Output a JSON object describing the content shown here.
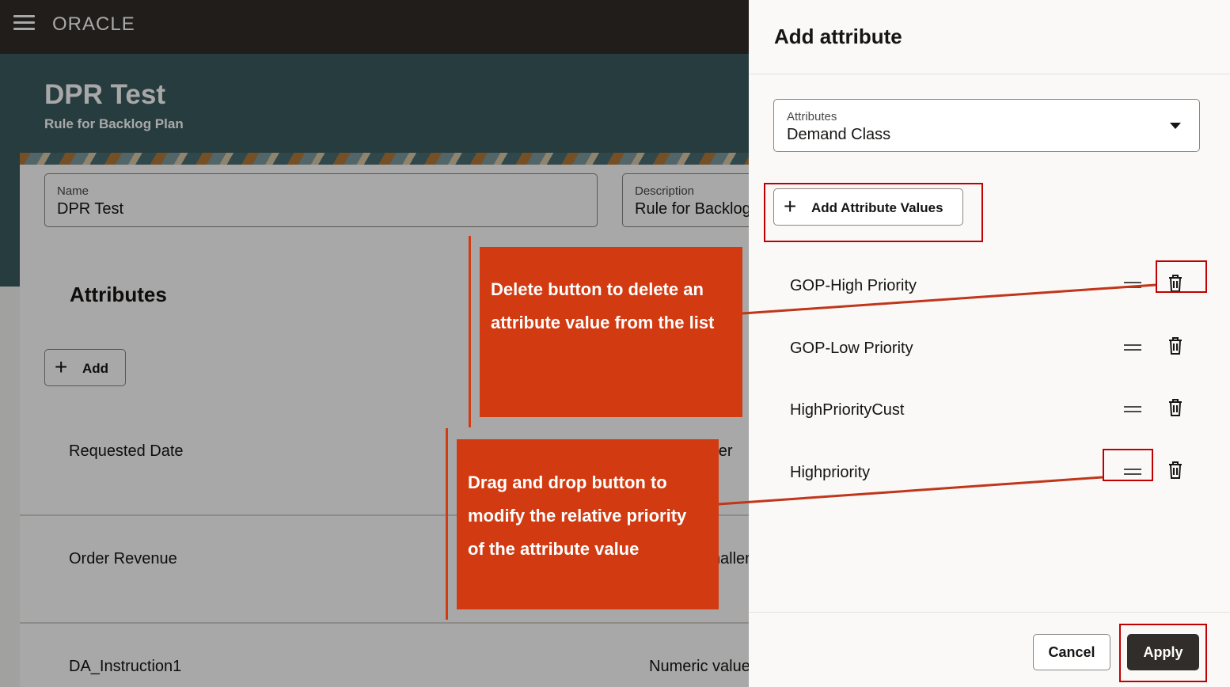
{
  "header": {
    "logo": "ORACLE"
  },
  "hero": {
    "title": "DPR Test",
    "subtitle": "Rule for Backlog Plan"
  },
  "form": {
    "name_label": "Name",
    "name_value": "DPR Test",
    "description_label": "Description",
    "description_value": "Rule for Backlog Plan"
  },
  "attributes_section": {
    "title": "Attributes",
    "add_label": "Add",
    "rows": [
      {
        "name": "Requested Date",
        "value": "Later"
      },
      {
        "name": "Order Revenue",
        "value": "Smaller"
      },
      {
        "name": "DA_Instruction1",
        "value": "Numeric value"
      }
    ]
  },
  "drawer": {
    "title": "Add attribute",
    "select_label": "Attributes",
    "select_value": "Demand Class",
    "add_values_label": "Add Attribute Values",
    "values": [
      {
        "name": "GOP-High Priority"
      },
      {
        "name": "GOP-Low Priority"
      },
      {
        "name": "HighPriorityCust"
      },
      {
        "name": "Highpriority"
      }
    ],
    "cancel_label": "Cancel",
    "apply_label": "Apply"
  },
  "annotations": {
    "delete_callout": "Delete button to delete an attribute value from the list",
    "drag_callout": "Drag and drop button to modify the relative priority of the attribute value"
  },
  "colors": {
    "header_bg": "#312d2a",
    "hero_bg": "#3c5b60",
    "callout_bg": "#d23a11",
    "highlight_border": "#c00000",
    "apply_bg": "#312d2a"
  }
}
